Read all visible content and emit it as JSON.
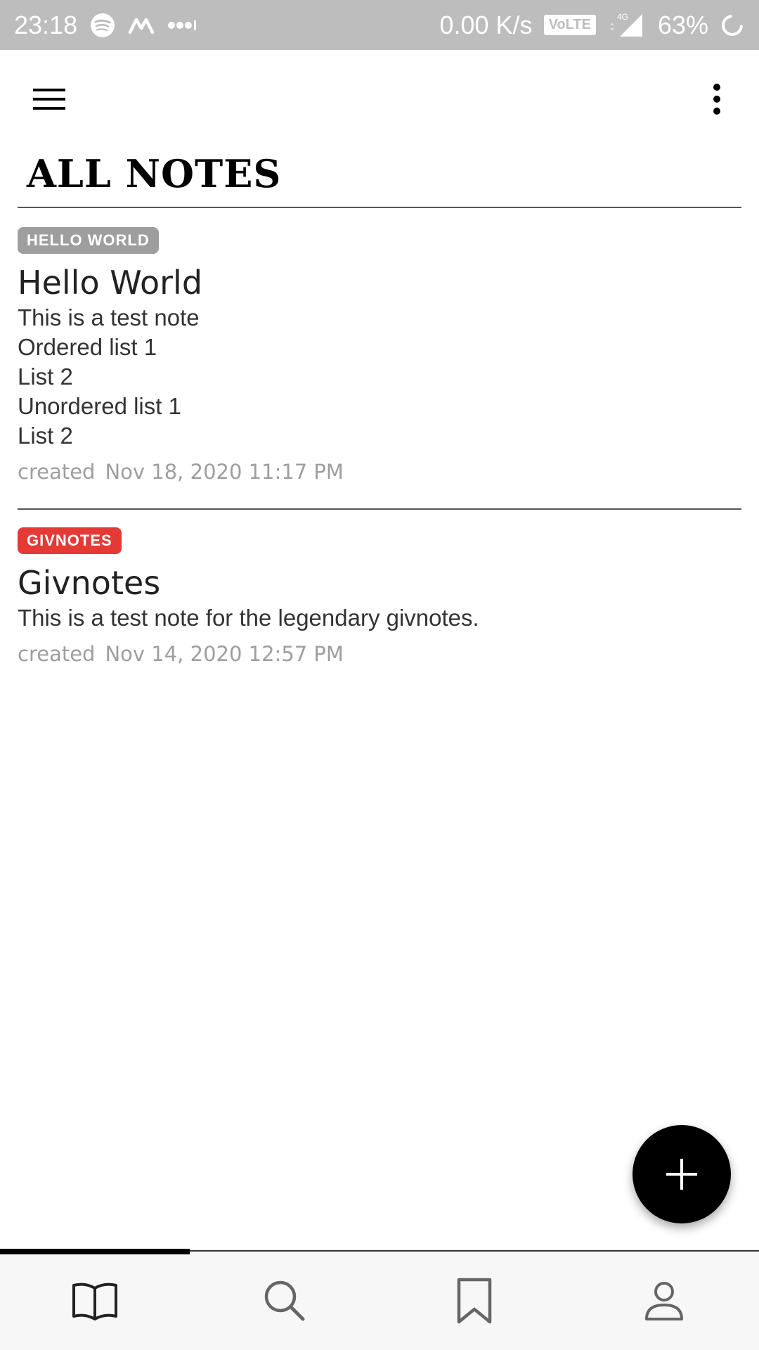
{
  "status_bar": {
    "time": "23:18",
    "speed": "0.00 K/s",
    "volte": "VoLTE",
    "network": "4G",
    "battery": "63%",
    "icons": [
      "spotify-icon",
      "m-app-icon",
      "more-notifications-icon",
      "signal-icon",
      "battery-loading-icon"
    ]
  },
  "app_bar": {
    "menu_icon": "hamburger-menu-icon",
    "more_icon": "more-vertical-icon"
  },
  "page": {
    "title": "ALL NOTES"
  },
  "notes": [
    {
      "tag": "HELLO WORLD",
      "tag_color": "#9e9e9e",
      "title": "Hello World",
      "lines": [
        "This is a test note",
        "Ordered list 1",
        "List 2",
        "Unordered list 1",
        "List 2"
      ],
      "created_label": "created",
      "created_at": "Nov 18, 2020 11:17 PM"
    },
    {
      "tag": "GIVNOTES",
      "tag_color": "#e53935",
      "title": "Givnotes",
      "lines": [
        "This is a test note for the legendary givnotes."
      ],
      "created_label": "created",
      "created_at": "Nov 14, 2020 12:57 PM"
    }
  ],
  "fab": {
    "icon": "plus-icon"
  },
  "bottom_nav": {
    "active_index": 0,
    "items": [
      {
        "icon": "book-icon"
      },
      {
        "icon": "search-icon"
      },
      {
        "icon": "bookmark-icon"
      },
      {
        "icon": "profile-icon"
      }
    ]
  }
}
